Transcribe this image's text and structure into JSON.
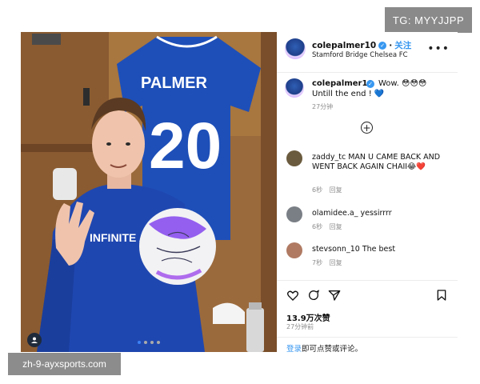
{
  "watermarks": {
    "top": "TG: MYYJJPP",
    "bottom": "zh-9-ayxsports.com"
  },
  "photo": {
    "jersey_name": "PALMER",
    "jersey_number": "20",
    "shirt_sponsor": "INFINITE ATHLETE",
    "carousel": {
      "count": 4,
      "active": 0
    }
  },
  "post": {
    "username": "colepalmer10",
    "follow_label": "关注",
    "location": "Stamford Bridge Chelsea FC",
    "more_label": "•••",
    "caption_user": "colepalmer10",
    "caption_text": "Wow. 😳😳😳",
    "caption_text2": "Untill the end ! 💙",
    "caption_time": "27分钟",
    "load_more_label": "+",
    "comments": [
      {
        "user": "zaddy_tc",
        "text": "MAN U CAME BACK AND WENT BACK AGAIN CHAII😂❤️",
        "time": "6秒",
        "reply": "回复",
        "avatar_color": "#6b5b3e"
      },
      {
        "user": "olamidee.a_",
        "text": "yessirrrr",
        "time": "6秒",
        "reply": "回复",
        "avatar_color": "#7a7f86"
      },
      {
        "user": "stevsonn_10",
        "text": "The best",
        "time": "7秒",
        "reply": "回复",
        "avatar_color": "#b07a62"
      }
    ],
    "likes": "13.9万次赞",
    "post_time": "27分钟前",
    "login_link": "登录",
    "login_text": "即可点赞或评论。"
  },
  "colors": {
    "accent": "#3797f0",
    "chelsea_blue": "#1e4fb8",
    "wood": "#9b6a3c"
  }
}
